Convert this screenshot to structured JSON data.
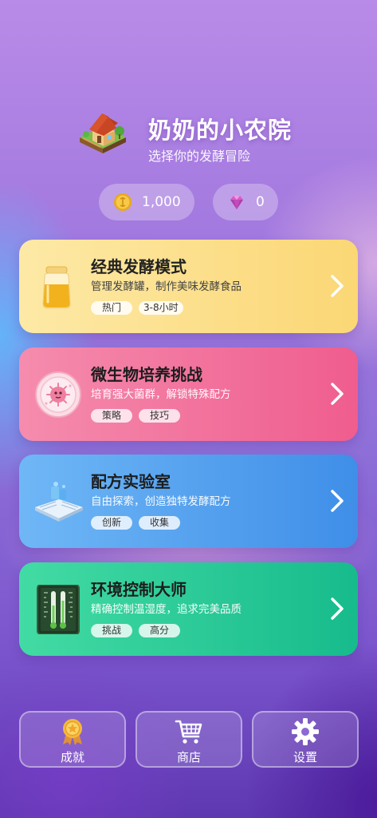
{
  "header": {
    "title": "奶奶的小农院",
    "subtitle": "选择你的发酵冒险",
    "logo_icon": "farmhouse-icon"
  },
  "currency": {
    "coins": "1,000",
    "coin_icon": "gold-coin-icon",
    "gems": "0",
    "gem_icon": "gem-icon"
  },
  "modes": [
    {
      "title": "经典发酵模式",
      "description": "管理发酵罐，制作美味发酵食品",
      "tags": [
        "热门",
        "3-8小时"
      ],
      "icon": "honey-jar-icon",
      "color": "#fbd775"
    },
    {
      "title": "微生物培养挑战",
      "description": "培育强大菌群，解锁特殊配方",
      "tags": [
        "策略",
        "技巧"
      ],
      "icon": "petri-dish-icon",
      "color": "#ef5d8e"
    },
    {
      "title": "配方实验室",
      "description": "自由探索，创造独特发酵配方",
      "tags": [
        "创新",
        "收集"
      ],
      "icon": "recipe-book-icon",
      "color": "#3f8ee8"
    },
    {
      "title": "环境控制大师",
      "description": "精确控制温湿度，追求完美品质",
      "tags": [
        "挑战",
        "高分"
      ],
      "icon": "thermometer-icon",
      "color": "#17bb8c"
    }
  ],
  "bottom_nav": [
    {
      "label": "成就",
      "icon": "medal-icon"
    },
    {
      "label": "商店",
      "icon": "cart-icon"
    },
    {
      "label": "设置",
      "icon": "gear-icon"
    }
  ]
}
